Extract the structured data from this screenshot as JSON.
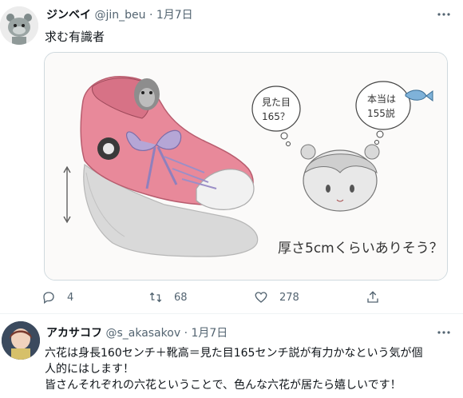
{
  "tweet1": {
    "display_name": "ジンベイ",
    "handle": "@jin_beu",
    "separator": "·",
    "date": "1月7日",
    "text": "求む有識者",
    "image_text": {
      "bubble_left_line1": "見た目",
      "bubble_left_line2": "165？",
      "bubble_right_line1": "本当は",
      "bubble_right_line2": "155説",
      "caption": "厚さ5cmくらいありそう？"
    },
    "actions": {
      "replies": "4",
      "retweets": "68",
      "likes": "278"
    }
  },
  "tweet2": {
    "display_name": "アカサコフ",
    "handle": "@s_akasakov",
    "separator": "·",
    "date": "1月7日",
    "text_line1": "六花は身長160センチ＋靴高＝見た目165センチ説が有力かなという気が個",
    "text_line2": "人的にはします！",
    "text_line3": "皆さんそれぞれの六花ということで、色んな六花が居たら嬉しいです！"
  },
  "colors": {
    "text_primary": "#0f1419",
    "text_secondary": "#536471",
    "border": "#cfd9de",
    "shoe_pink": "#e8899a",
    "shoe_sole": "#c9c9c9"
  },
  "icons": [
    "more-icon",
    "reply-icon",
    "retweet-icon",
    "like-icon",
    "share-icon"
  ]
}
